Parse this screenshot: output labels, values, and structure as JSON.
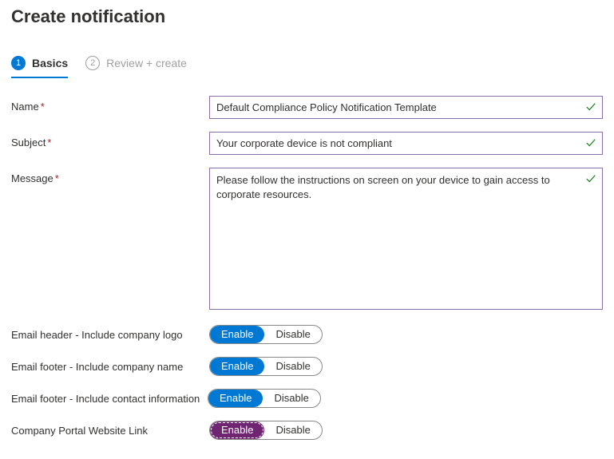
{
  "page": {
    "title": "Create notification"
  },
  "tabs": {
    "basics": {
      "num": "1",
      "label": "Basics"
    },
    "review": {
      "num": "2",
      "label": "Review + create"
    }
  },
  "form": {
    "name": {
      "label": "Name",
      "value": "Default Compliance Policy Notification Template"
    },
    "subject": {
      "label": "Subject",
      "value": "Your corporate device is not compliant"
    },
    "message": {
      "label": "Message",
      "value": "Please follow the instructions on screen on your device to gain access to corporate resources."
    }
  },
  "toggles": {
    "header_logo": {
      "label": "Email header - Include company logo",
      "enable": "Enable",
      "disable": "Disable"
    },
    "footer_name": {
      "label": "Email footer - Include company name",
      "enable": "Enable",
      "disable": "Disable"
    },
    "footer_contact": {
      "label": "Email footer - Include contact information",
      "enable": "Enable",
      "disable": "Disable"
    },
    "portal_link": {
      "label": "Company Portal Website Link",
      "enable": "Enable",
      "disable": "Disable"
    }
  }
}
